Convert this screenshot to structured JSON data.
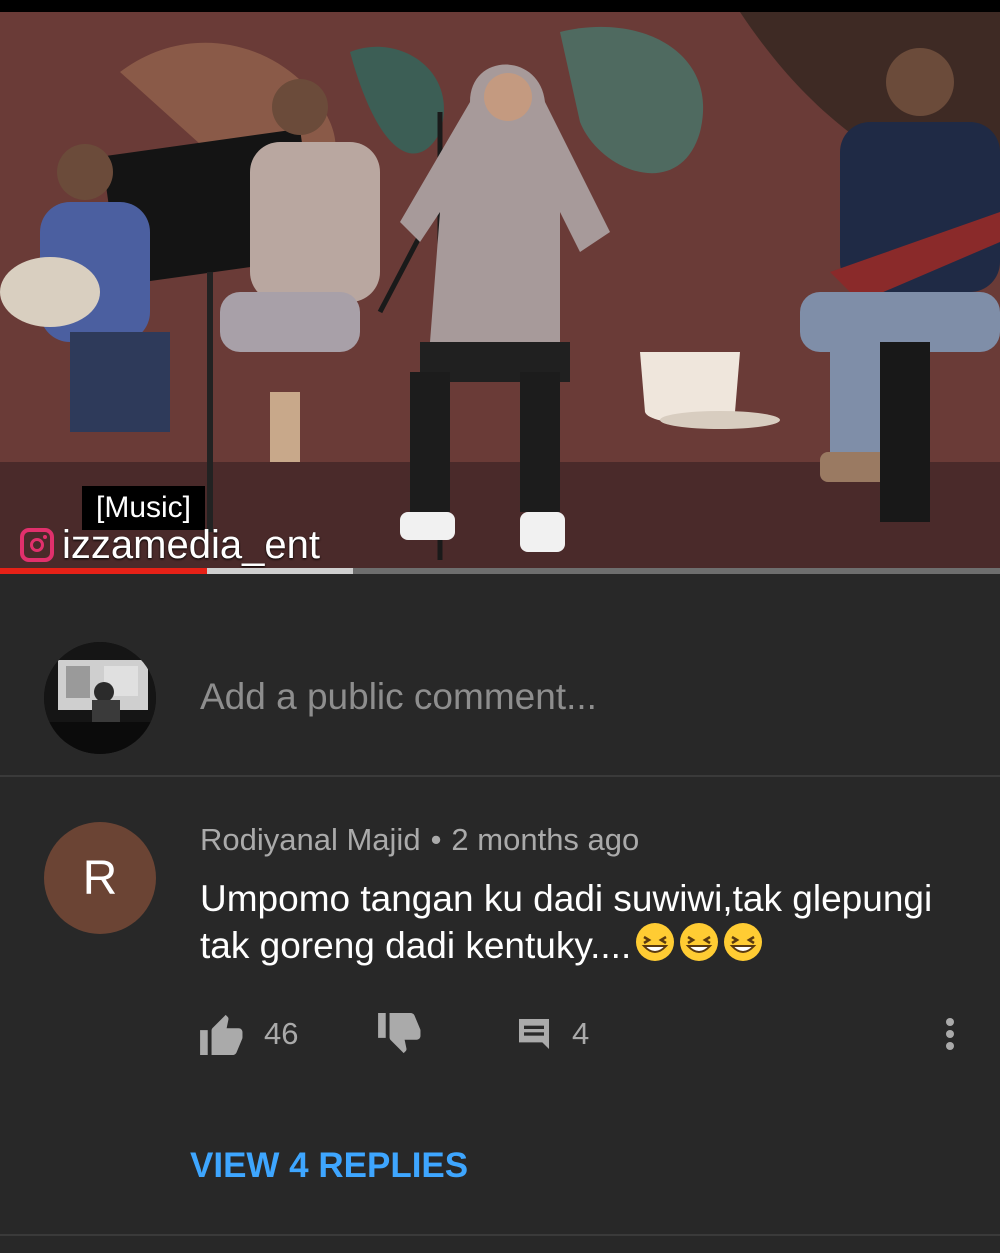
{
  "player": {
    "caption": "[Music]",
    "watermark": "izzamedia_ent",
    "progress": {
      "played_fraction": 0.207,
      "buffered_fraction": 0.353
    }
  },
  "composer": {
    "placeholder": "Add a public comment..."
  },
  "comment": {
    "avatar_letter": "R",
    "author": "Rodiyanal Majid",
    "time": "2 months ago",
    "text": "Umpomo tangan ku dadi suwiwi,tak glepungi tak goreng dadi kentuky....",
    "emojis": [
      "grinning-squinting-face",
      "grinning-squinting-face",
      "grinning-squinting-face"
    ],
    "likes": "46",
    "replies": "4",
    "view_replies_label": "VIEW 4 REPLIES"
  },
  "colors": {
    "background": "#282828",
    "link": "#3ea6ff",
    "progress_played": "#e62117",
    "avatar_bg": "#6b4434"
  }
}
